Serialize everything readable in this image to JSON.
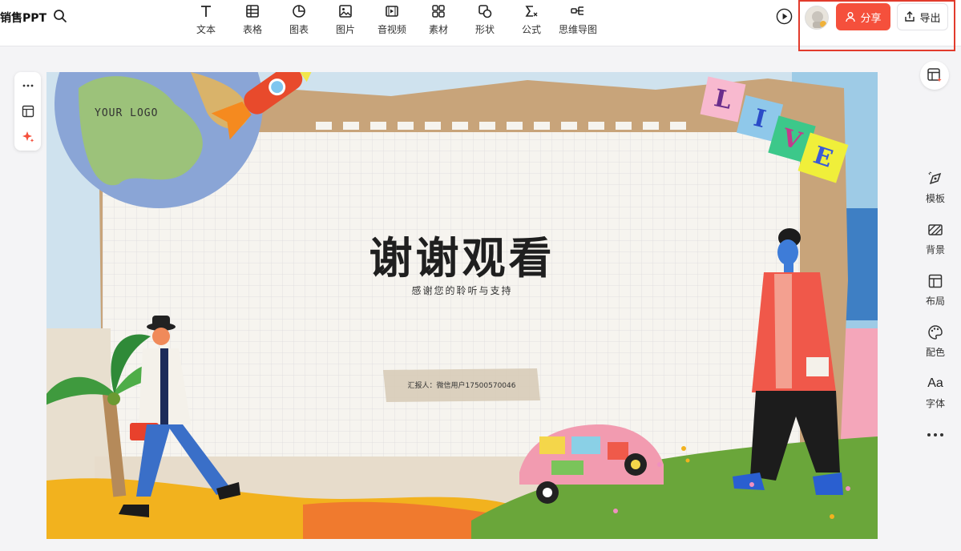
{
  "header": {
    "doc_title": "销售PPT",
    "tools": [
      {
        "icon": "text-icon",
        "label": "文本"
      },
      {
        "icon": "table-icon",
        "label": "表格"
      },
      {
        "icon": "chart-icon",
        "label": "图表"
      },
      {
        "icon": "image-icon",
        "label": "图片"
      },
      {
        "icon": "video-icon",
        "label": "音视频"
      },
      {
        "icon": "material-icon",
        "label": "素材"
      },
      {
        "icon": "shape-icon",
        "label": "形状"
      },
      {
        "icon": "formula-icon",
        "label": "公式"
      },
      {
        "icon": "mindmap-icon",
        "label": "思维导图"
      }
    ],
    "share_label": "分享",
    "export_label": "导出"
  },
  "right_panel": {
    "items": [
      {
        "icon": "template-icon",
        "label": "模板"
      },
      {
        "icon": "background-icon",
        "label": "背景"
      },
      {
        "icon": "layout-icon",
        "label": "布局"
      },
      {
        "icon": "palette-icon",
        "label": "配色"
      },
      {
        "icon": "font-icon",
        "label": "字体"
      }
    ]
  },
  "slide": {
    "logo": "YOUR LOGO",
    "title": "谢谢观看",
    "subtitle": "感谢您的聆听与支持",
    "reporter": "汇报人：微信用户17500570046",
    "live_letters": [
      "L",
      "I",
      "V",
      "E"
    ]
  },
  "colors": {
    "accent": "#f5503c",
    "highlight_outline": "#e23b2c"
  }
}
